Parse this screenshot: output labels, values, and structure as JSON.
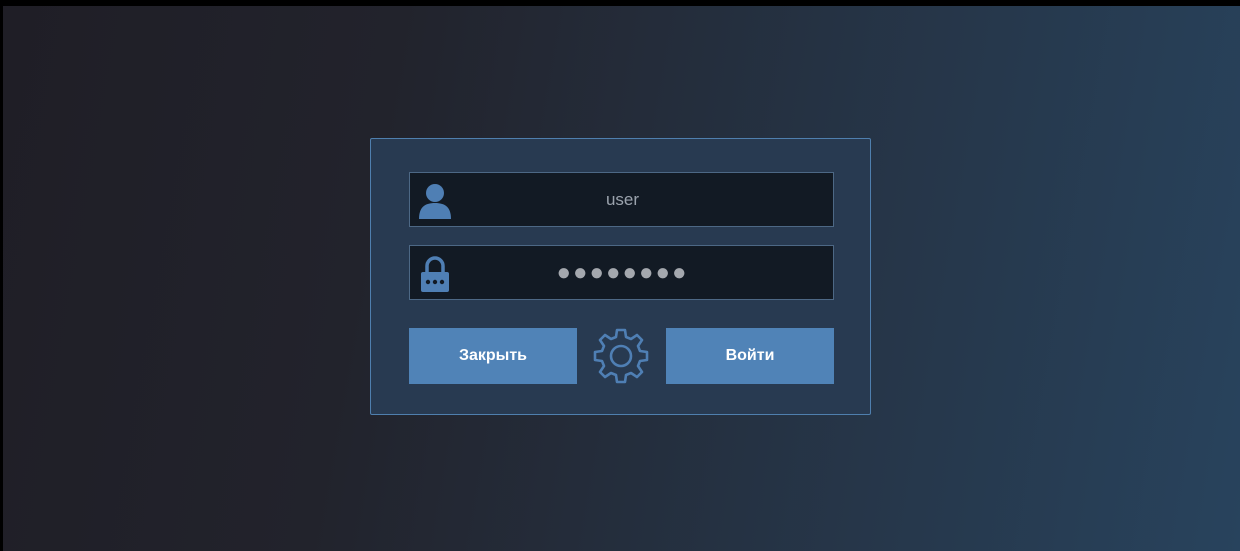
{
  "login_form": {
    "username": {
      "value": "user",
      "icon": "user-icon"
    },
    "password": {
      "value": "●●●●●●●●",
      "icon": "lock-icon"
    },
    "buttons": {
      "close_label": "Закрыть",
      "login_label": "Войти"
    },
    "settings_icon": "gear-icon"
  },
  "colors": {
    "panel_background": "#283a51",
    "panel_border": "#4f7fae",
    "field_background": "#121a24",
    "button_background": "#5083b7",
    "icon_color": "#4f7fb4"
  }
}
